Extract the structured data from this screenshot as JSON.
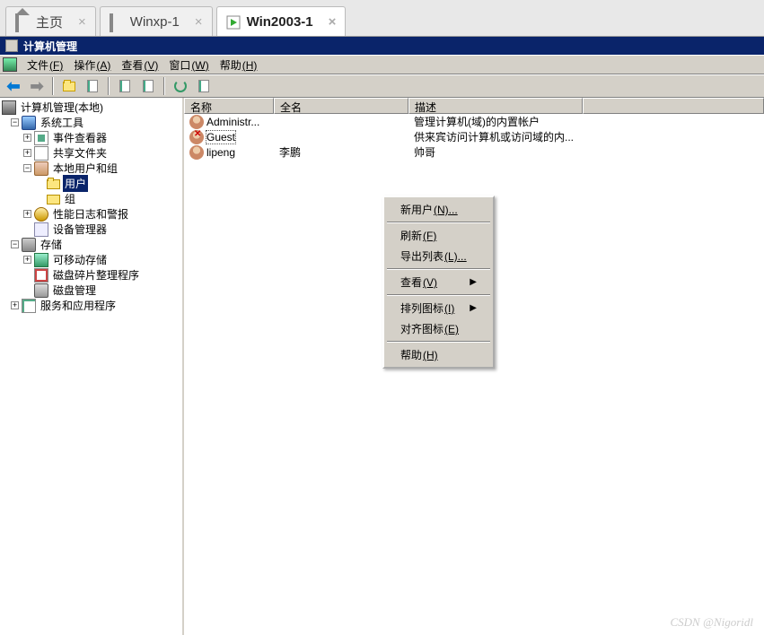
{
  "tabs": [
    {
      "label": "主页"
    },
    {
      "label": "Winxp-1"
    },
    {
      "label": "Win2003-1"
    }
  ],
  "window_title": "计算机管理",
  "menu": {
    "file": {
      "label": "文件",
      "mnemonic": "(F)"
    },
    "action": {
      "label": "操作",
      "mnemonic": "(A)"
    },
    "view": {
      "label": "查看",
      "mnemonic": "(V)"
    },
    "window": {
      "label": "窗口",
      "mnemonic": "(W)"
    },
    "help": {
      "label": "帮助",
      "mnemonic": "(H)"
    }
  },
  "tree": {
    "root": "计算机管理(本地)",
    "system_tools": "系统工具",
    "event_viewer": "事件查看器",
    "shared_folders": "共享文件夹",
    "local_users": "本地用户和组",
    "users": "用户",
    "groups": "组",
    "perf_logs": "性能日志和警报",
    "device_mgr": "设备管理器",
    "storage": "存储",
    "removable": "可移动存储",
    "defrag": "磁盘碎片整理程序",
    "disk_mgmt": "磁盘管理",
    "services_apps": "服务和应用程序"
  },
  "list": {
    "headers": {
      "name": "名称",
      "fullname": "全名",
      "desc": "描述"
    },
    "rows": [
      {
        "name": "Administr...",
        "fullname": "",
        "desc": "管理计算机(域)的内置帐户"
      },
      {
        "name": "Guest",
        "fullname": "",
        "desc": "供来宾访问计算机或访问域的内..."
      },
      {
        "name": "lipeng",
        "fullname": "李鹏",
        "desc": "帅哥"
      }
    ]
  },
  "context_menu": {
    "new_user": {
      "label": "新用户",
      "mnemonic": "(N)...",
      "suffix": ""
    },
    "refresh": {
      "label": "刷新",
      "mnemonic": "(F)"
    },
    "export": {
      "label": "导出列表",
      "mnemonic": "(L)..."
    },
    "view": {
      "label": "查看",
      "mnemonic": "(V)"
    },
    "arrange": {
      "label": "排列图标",
      "mnemonic": "(I)"
    },
    "align": {
      "label": "对齐图标",
      "mnemonic": "(E)"
    },
    "help": {
      "label": "帮助",
      "mnemonic": "(H)"
    }
  },
  "watermark": "CSDN @Nigoridl"
}
